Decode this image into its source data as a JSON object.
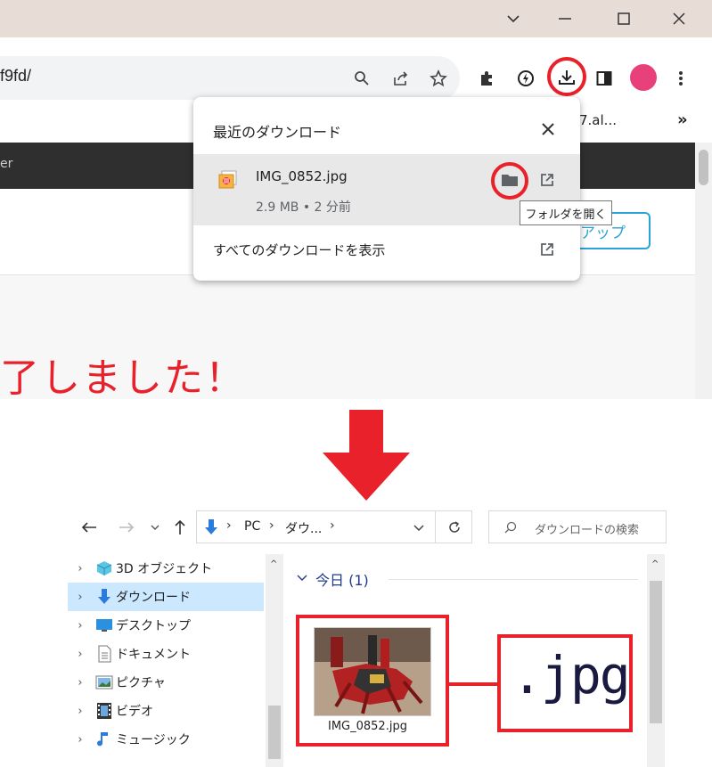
{
  "browser": {
    "url_fragment": "f9fd/",
    "bookmark_overflow": "7.al...",
    "more_bookmarks": "»",
    "dark_bar_text": "er"
  },
  "download_popup": {
    "title": "最近のダウンロード",
    "file_name": "IMG_0852.jpg",
    "file_meta": "2.9 MB • 2 分前",
    "show_all": "すべてのダウンロードを表示",
    "tooltip": "フォルダを開く"
  },
  "page": {
    "button_label": "アップ",
    "message": "了しました！"
  },
  "explorer": {
    "breadcrumb": [
      "PC",
      "ダウ..."
    ],
    "search_placeholder": "ダウンロードの検索",
    "group_label": "今日 (1)",
    "file_name": "IMG_0852.jpg",
    "callout_ext": ".jpg",
    "tree": [
      {
        "label": "3D オブジェクト",
        "icon": "3d-objects-icon"
      },
      {
        "label": "ダウンロード",
        "icon": "download-arrow-icon",
        "selected": true
      },
      {
        "label": "デスクトップ",
        "icon": "desktop-icon"
      },
      {
        "label": "ドキュメント",
        "icon": "document-icon"
      },
      {
        "label": "ピクチャ",
        "icon": "pictures-icon"
      },
      {
        "label": "ビデオ",
        "icon": "video-icon"
      },
      {
        "label": "ミュージック",
        "icon": "music-icon"
      }
    ]
  },
  "colors": {
    "highlight_red": "#e8212a",
    "titlebar": "#e8dcd7",
    "accent_blue": "#2aa3d8",
    "selection": "#cce8ff"
  }
}
